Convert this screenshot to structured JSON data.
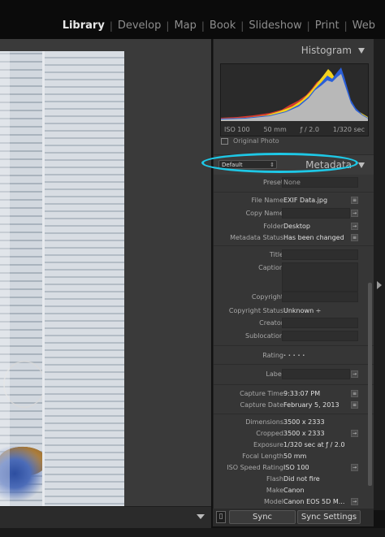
{
  "modules": [
    "Library",
    "Develop",
    "Map",
    "Book",
    "Slideshow",
    "Print",
    "Web"
  ],
  "active_module": "Library",
  "histogram": {
    "title": "Histogram",
    "iso": "ISO 100",
    "focal": "50 mm",
    "aperture": "ƒ / 2.0",
    "shutter": "1/320 sec",
    "original_photo": "Original Photo"
  },
  "metadata": {
    "title": "Metadata",
    "preset_select": "Default",
    "highlight_color": "#1ec8e6",
    "preset_label": "Preset",
    "preset_value": "None",
    "fields": {
      "file_name_label": "File Name",
      "file_name": "EXIF Data.jpg",
      "copy_name_label": "Copy Name",
      "folder_label": "Folder",
      "folder": "Desktop",
      "metadata_status_label": "Metadata Status",
      "metadata_status": "Has been changed",
      "title_label": "Title",
      "caption_label": "Caption",
      "copyright_label": "Copyright",
      "copyright_status_label": "Copyright Status",
      "copyright_status": "Unknown ÷",
      "creator_label": "Creator",
      "sublocation_label": "Sublocation",
      "rating_label": "Rating",
      "rating": "· · · · ·",
      "label_label": "Label",
      "capture_time_label": "Capture Time",
      "capture_time": "9:33:07 PM",
      "capture_date_label": "Capture Date",
      "capture_date": "February 5, 2013",
      "dimensions_label": "Dimensions",
      "dimensions": "3500 x 2333",
      "cropped_label": "Cropped",
      "cropped": "3500 x 2333",
      "exposure_label": "Exposure",
      "exposure": "1/320 sec at ƒ / 2.0",
      "focal_length_label": "Focal Length",
      "focal_length": "50 mm",
      "iso_label": "ISO Speed Rating",
      "iso": "ISO 100",
      "flash_label": "Flash",
      "flash": "Did not fire",
      "make_label": "Make",
      "make": "Canon",
      "model_label": "Model",
      "model": "Canon EOS 5D M..."
    }
  },
  "sync": {
    "sync_label": "Sync",
    "sync_settings_label": "Sync Settings"
  }
}
